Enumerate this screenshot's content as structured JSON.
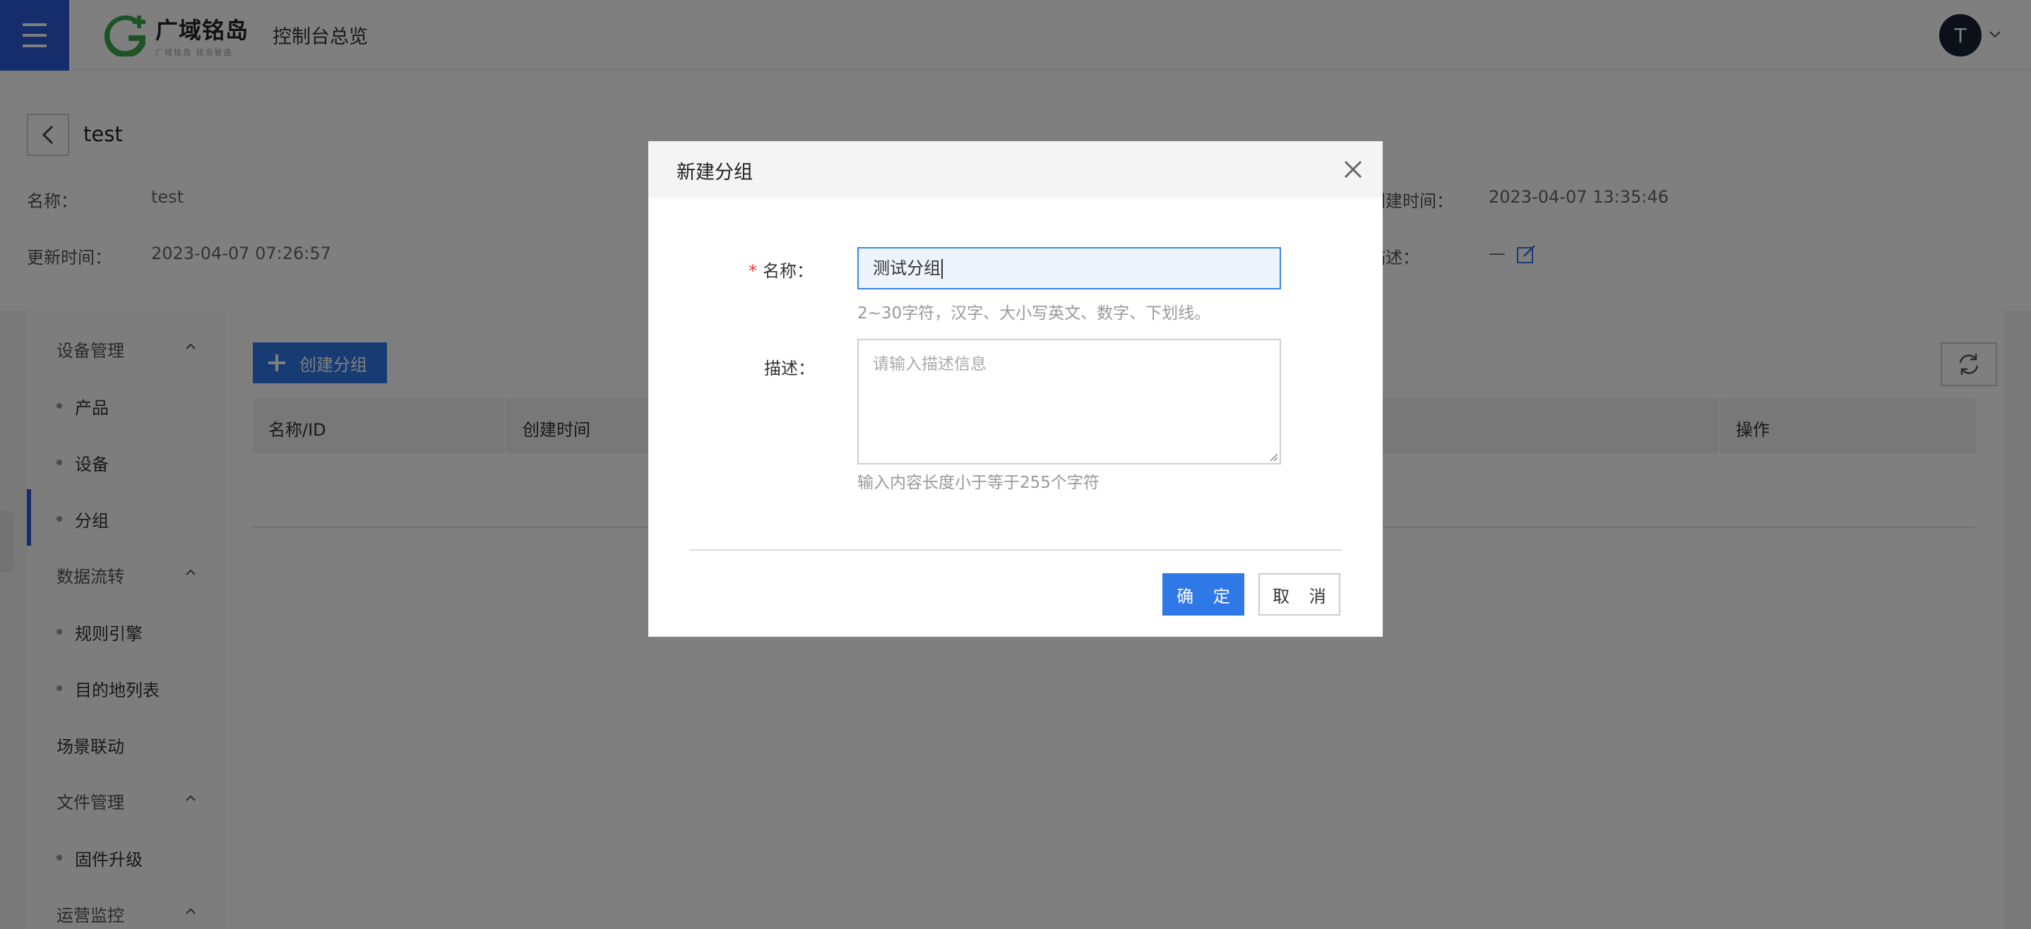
{
  "header": {
    "menu_icon": "hamburger-menu-icon",
    "logo_name": "广域铭岛",
    "logo_subtitle": "广域铭岛 铭岛智造",
    "console_title": "控制台总览",
    "avatar_initial": "T"
  },
  "detail": {
    "back_icon": "chevron-left-icon",
    "title": "test",
    "name_label": "名称：",
    "name_value": "test",
    "updated_label": "更新时间：",
    "updated_value": "2023-04-07 07:26:57",
    "created_label": "创建时间：",
    "created_value": "2023-04-07 13:35:46",
    "desc_label": "描述：",
    "desc_value": "—"
  },
  "sidebar": {
    "groups": [
      {
        "label": "设备管理",
        "items": [
          "产品",
          "设备",
          "分组"
        ]
      },
      {
        "label": "数据流转",
        "items": [
          "规则引擎",
          "目的地列表"
        ]
      },
      {
        "label": "场景联动"
      },
      {
        "label": "文件管理",
        "items": [
          "固件升级"
        ]
      },
      {
        "label": "运营监控"
      }
    ],
    "active_item": "分组"
  },
  "content": {
    "create_button": "创建分组",
    "table_headers": [
      "名称/ID",
      "创建时间",
      "操作"
    ]
  },
  "modal": {
    "title": "新建分组",
    "name_label": "名称：",
    "name_value": "测试分组",
    "name_help": "2~30字符，汉字、大小写英文、数字、下划线。",
    "desc_label": "描述：",
    "desc_placeholder": "请输入描述信息",
    "desc_help": "输入内容长度小于等于255个字符",
    "ok_button": "确 定",
    "cancel_button": "取 消"
  },
  "colors": {
    "primary": "#2f78e8",
    "menu_bg": "#2a5bd7",
    "logo_green": "#3aa64a",
    "required": "#e33333"
  }
}
